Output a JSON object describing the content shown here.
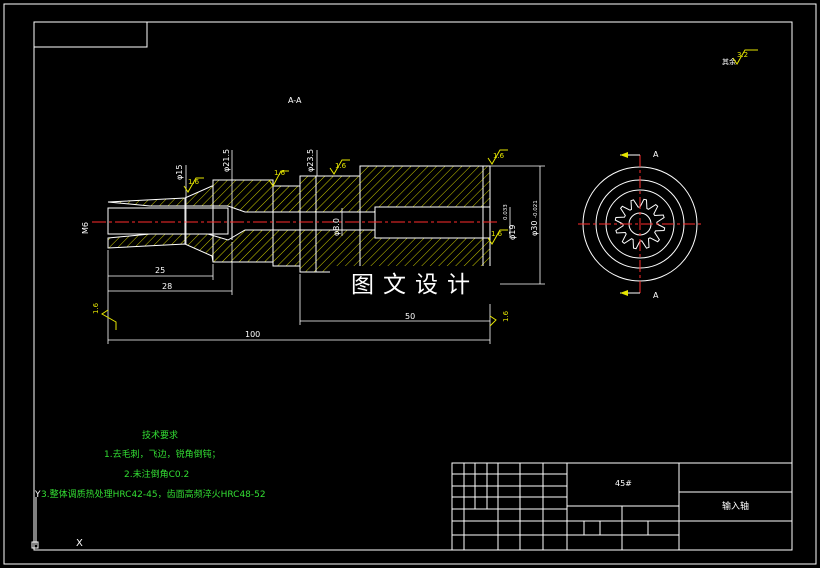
{
  "section_label": "A-A",
  "view_marks": {
    "top": "A",
    "bottom": "A"
  },
  "roughness_note": {
    "prefix": "其余",
    "value": "3.2"
  },
  "dims": {
    "d_m6": "M6",
    "d15": "φ15",
    "d21_5": "φ21.5",
    "d23_5": "φ23.5",
    "d8": "φ8.0",
    "d19": "φ19",
    "d19_tol": "0.033",
    "d30": "φ30",
    "d30_tol": "-0.021",
    "l25": "25",
    "l28": "28",
    "l50": "50",
    "l100": "100"
  },
  "roughness_marks": [
    "1.6",
    "1.6",
    "1.6",
    "1.6",
    "1.6",
    "1.6",
    "1.6"
  ],
  "watermark": "图文设计",
  "tech_requirements": {
    "title": "技术要求",
    "items": [
      "1.去毛刺，飞边，锐角倒钝；",
      "2.未注倒角C0.2",
      "3.整体调质热处理HRC42-45，齿面高频淬火HRC48-52"
    ]
  },
  "title_block": {
    "material": "45#",
    "part_name": "输入轴"
  },
  "ucs": {
    "y": "Y",
    "x": "X"
  }
}
